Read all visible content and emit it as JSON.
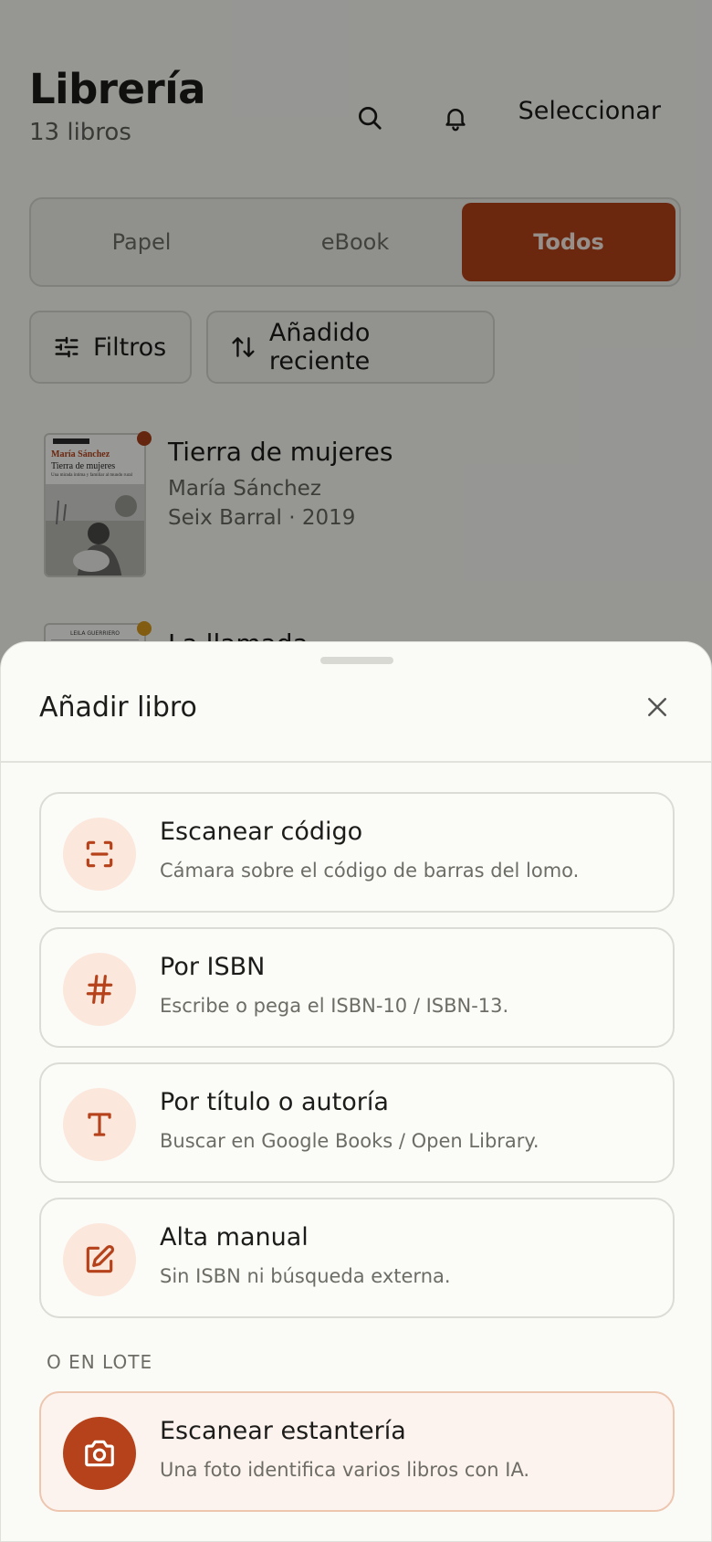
{
  "header": {
    "title": "Librería",
    "count": "13 libros",
    "select_label": "Seleccionar"
  },
  "format_tabs": [
    {
      "label": "Papel",
      "active": false
    },
    {
      "label": "eBook",
      "active": false
    },
    {
      "label": "Todos",
      "active": true
    }
  ],
  "toolbar": {
    "filters_label": "Filtros",
    "sort_label": "Añadido reciente"
  },
  "books": [
    {
      "title": "Tierra de mujeres",
      "author": "María Sánchez",
      "meta": "Seix Barral · 2019",
      "cover_author": "María Sánchez",
      "cover_title": "Tierra de mujeres",
      "cover_subtitle": "Una mirada íntima y familiar al mundo rural",
      "cover_publisher": "Seix Barral",
      "status_color": "#a8401a"
    },
    {
      "title": "La llamada",
      "cover_author": "LEILA GUERRIERO",
      "status_color": "#d99a1c"
    }
  ],
  "sheet": {
    "title": "Añadir libro",
    "options": [
      {
        "title": "Escanear código",
        "description": "Cámara sobre el código de barras del lomo.",
        "icon": "scan-icon"
      },
      {
        "title": "Por ISBN",
        "description": "Escribe o pega el ISBN-10 / ISBN-13.",
        "icon": "hash-icon"
      },
      {
        "title": "Por título o autoría",
        "description": "Buscar en Google Books / Open Library.",
        "icon": "text-icon"
      },
      {
        "title": "Alta manual",
        "description": "Sin ISBN ni búsqueda externa.",
        "icon": "edit-icon"
      }
    ],
    "batch_label": "O EN LOTE",
    "batch_option": {
      "title": "Escanear estantería",
      "description": "Una foto identifica varios libros con IA.",
      "icon": "camera-icon"
    }
  },
  "colors": {
    "accent": "#b5421a",
    "accent_soft": "#fbe7db",
    "background": "#fafaf6"
  }
}
